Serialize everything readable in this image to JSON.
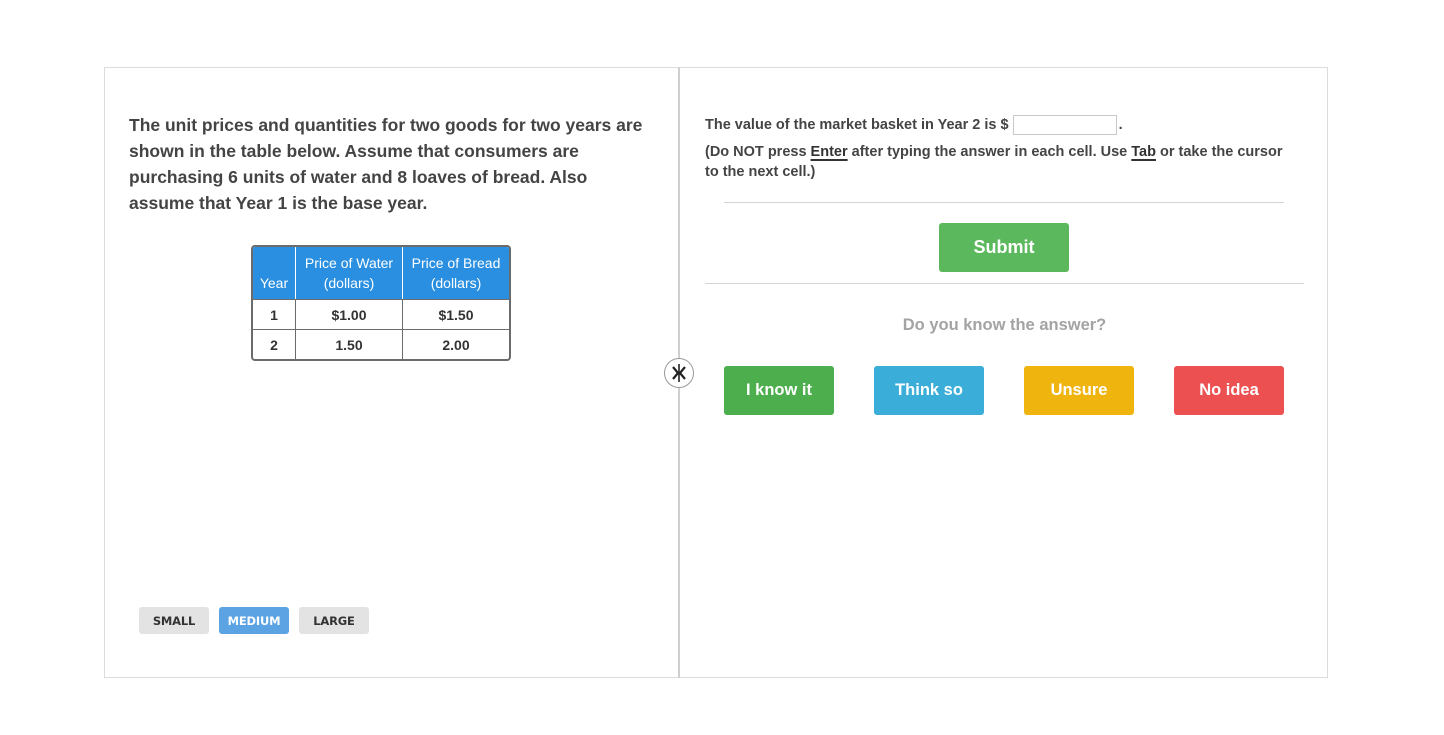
{
  "question": {
    "text": "The unit prices and quantities for two goods for two years are shown in the table below. Assume that consumers are purchasing 6 units of water and 8 loaves of bread. Also assume that Year 1 is the base year."
  },
  "table": {
    "headers": {
      "year": "Year",
      "water_line1": "Price of Water",
      "water_line2": "(dollars)",
      "bread_line1": "Price of Bread",
      "bread_line2": "(dollars)"
    },
    "rows": [
      {
        "year": "1",
        "water": "$1.00",
        "bread": "$1.50"
      },
      {
        "year": "2",
        "water": "1.50",
        "bread": "2.00"
      }
    ]
  },
  "text_size": {
    "small": "SMALL",
    "medium": "MEDIUM",
    "large": "LARGE",
    "selected": "medium"
  },
  "answer": {
    "prefix": "The value of the market basket in Year 2 is $",
    "suffix": ".",
    "value": "",
    "placeholder": ""
  },
  "instructions": {
    "part1": "(Do NOT press ",
    "enter_key": "Enter",
    "part2": " after typing the answer in each cell. Use ",
    "tab_key": "Tab",
    "part3": " or take the cursor to the next cell.)"
  },
  "submit": {
    "label": "Submit"
  },
  "confidence": {
    "question": "Do you know the answer?",
    "options": [
      "I know it",
      "Think so",
      "Unsure",
      "No idea"
    ]
  },
  "colors": {
    "table_header": "#2a8fe0",
    "submit": "#5cb85c",
    "know": "#4cae4c",
    "think": "#3aaed8",
    "unsure": "#f0b40f",
    "noidea": "#ec5050",
    "size_selected": "#5ba3e3"
  },
  "icons": {
    "split_handle": "collapse-arrows-icon"
  }
}
